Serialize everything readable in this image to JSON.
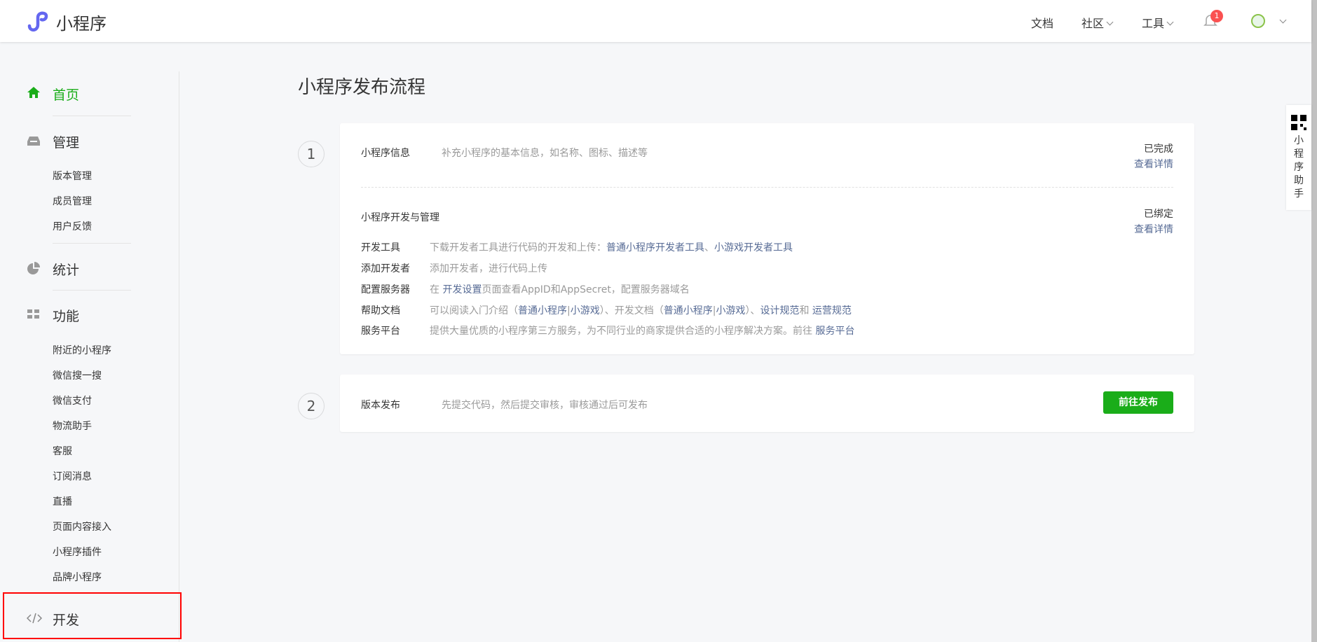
{
  "header": {
    "brand": "小程序",
    "nav": {
      "docs": "文档",
      "community": "社区",
      "tools": "工具"
    },
    "notification_count": "1"
  },
  "sidebar": {
    "home": "首页",
    "manage": {
      "label": "管理",
      "items": [
        "版本管理",
        "成员管理",
        "用户反馈"
      ]
    },
    "stats": "统计",
    "features": {
      "label": "功能",
      "items": [
        "附近的小程序",
        "微信搜一搜",
        "微信支付",
        "物流助手",
        "客服",
        "订阅消息",
        "直播",
        "页面内容接入",
        "小程序插件",
        "品牌小程序"
      ]
    },
    "develop": "开发"
  },
  "main": {
    "title": "小程序发布流程",
    "step1": {
      "number": "1",
      "info": {
        "label": "小程序信息",
        "desc": "补充小程序的基本信息，如名称、图标、描述等",
        "status": "已完成",
        "link": "查看详情"
      },
      "dev": {
        "label": "小程序开发与管理",
        "status": "已绑定",
        "link": "查看详情"
      },
      "rows": {
        "tools": {
          "label": "开发工具",
          "desc": "下载开发者工具进行代码的开发和上传：",
          "link1": "普通小程序开发者工具",
          "sep": "、",
          "link2": "小游戏开发者工具"
        },
        "add_dev": {
          "label": "添加开发者",
          "desc": "添加开发者，进行代码上传"
        },
        "server": {
          "label": "配置服务器",
          "pre": "在 ",
          "link": "开发设置",
          "desc": "页面查看AppID和AppSecret，配置服务器域名"
        },
        "help": {
          "label": "帮助文档",
          "t1": "可以阅读入门介绍（",
          "l1": "普通小程序",
          "bar": "|",
          "l2": "小游戏",
          "t2": "）、开发文档（",
          "l3": "普通小程序",
          "l4": "小游戏",
          "t3": "）、",
          "l5": "设计规范",
          "t4": "和 ",
          "l6": "运营规范"
        },
        "service": {
          "label": "服务平台",
          "desc": "提供大量优质的小程序第三方服务，为不同行业的商家提供合适的小程序解决方案。前往 ",
          "link": "服务平台"
        }
      }
    },
    "step2": {
      "number": "2",
      "label": "版本发布",
      "desc": "先提交代码，然后提交审核，审核通过后可发布",
      "button": "前往发布"
    }
  },
  "assistant": "小程序助手"
}
